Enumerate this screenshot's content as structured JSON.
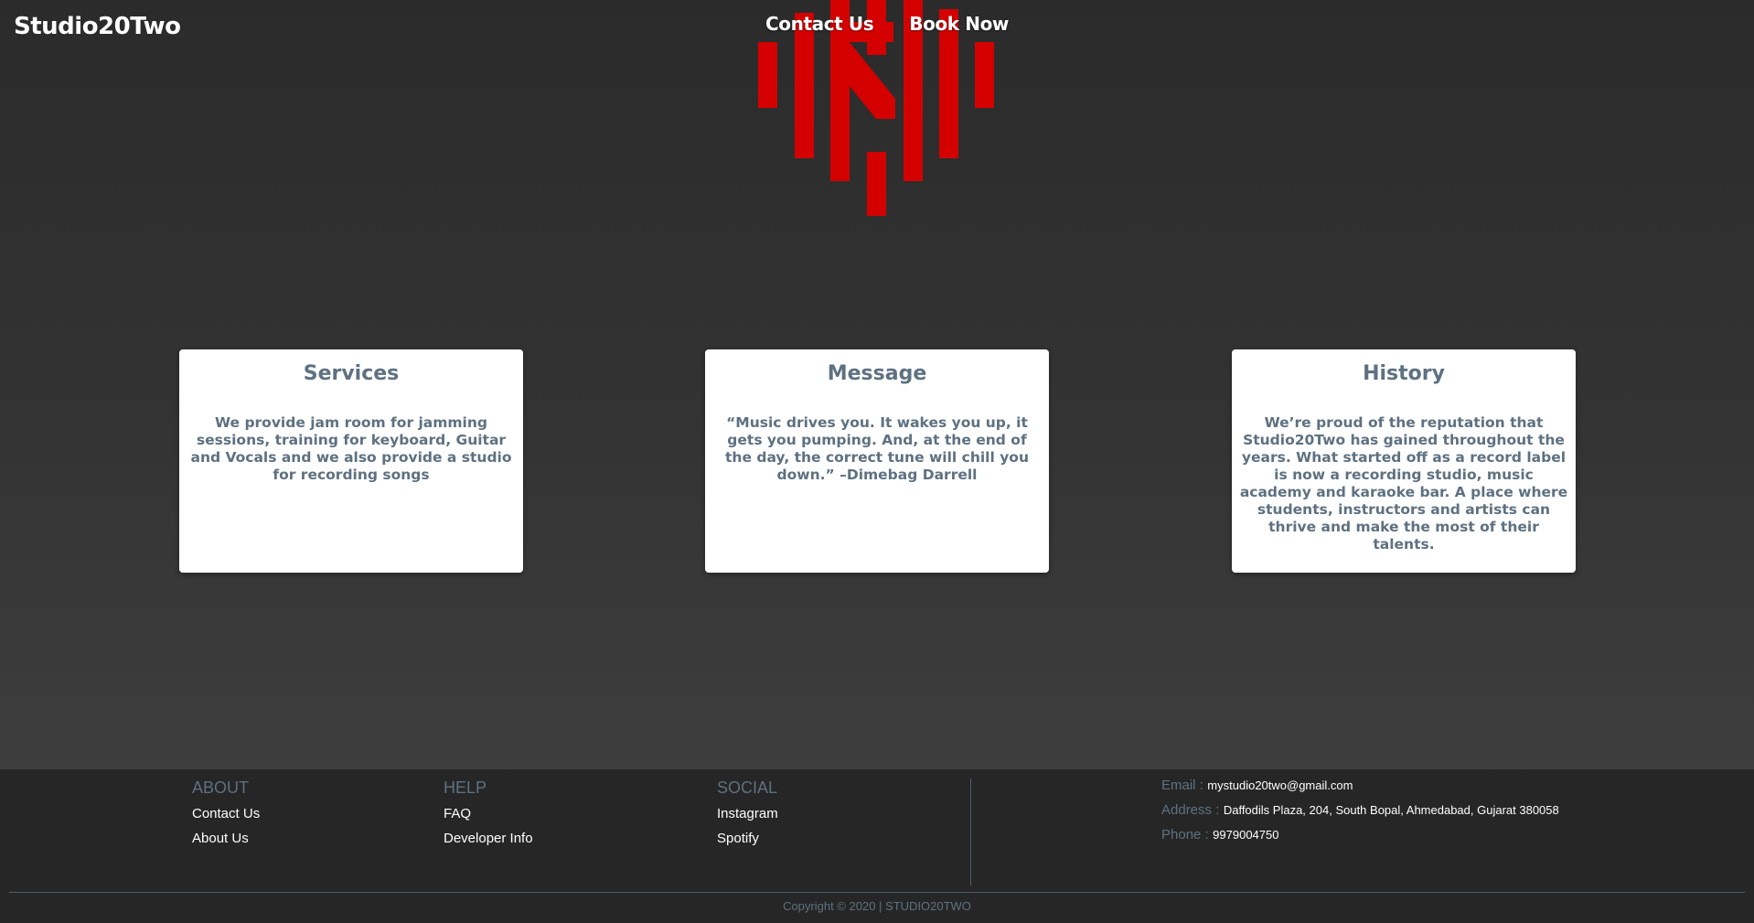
{
  "header": {
    "brand": "Studio20Two",
    "nav": [
      "Contact Us",
      "Book Now"
    ]
  },
  "logo": {
    "icon": "studio-logo-icon",
    "color": "#d40000"
  },
  "cards": [
    {
      "title": "Services",
      "text": "We provide jam room for jamming sessions, training for keyboard, Guitar and Vocals and we also provide a studio for recording songs"
    },
    {
      "title": "Message",
      "text": "“Music drives you. It wakes you up, it gets you pumping. And, at the end of the day, the correct tune will chill you down.” –Dimebag Darrell"
    },
    {
      "title": "History",
      "text": "We’re proud of the reputation that Studio20Two has gained throughout the years. What started off as a record label is now a recording studio, music academy and karaoke bar. A place where students, instructors and artists can thrive and make the most of their talents."
    }
  ],
  "footer": {
    "about": {
      "title": "ABOUT",
      "links": [
        "Contact Us",
        "About Us"
      ]
    },
    "help": {
      "title": "HELP",
      "links": [
        "FAQ",
        "Developer Info"
      ]
    },
    "social": {
      "title": "SOCIAL",
      "links": [
        "Instagram",
        "Spotify"
      ]
    },
    "contact": {
      "email_label": "Email :",
      "email": "mystudio20two@gmail.com",
      "address_label": "Address :",
      "address": "Daffodils Plaza, 204, South Bopal, Ahmedabad, Gujarat 380058",
      "phone_label": "Phone :",
      "phone": "9979004750"
    },
    "copyright": "Copyright © 2020 | STUDIO20TWO"
  }
}
